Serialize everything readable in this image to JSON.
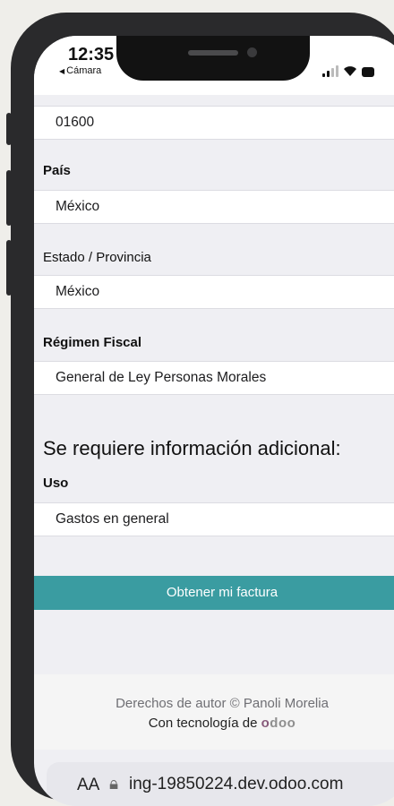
{
  "status_bar": {
    "time": "12:35",
    "back_app": "Cámara"
  },
  "form": {
    "postal_code_value": "01600",
    "country_label": "País",
    "country_value": "México",
    "state_label": "Estado / Provincia",
    "state_value": "México",
    "regime_label": "Régimen Fiscal",
    "regime_value": "General de Ley Personas Morales",
    "additional_title": "Se requiere información adicional:",
    "use_label": "Uso",
    "use_value": "Gastos en general",
    "submit_label": "Obtener mi factura"
  },
  "footer": {
    "copyright": "Derechos de autor © Panoli Morelia",
    "powered_by": "Con tecnología de",
    "brand": "odoo"
  },
  "browser": {
    "aa": "AA",
    "url": "ing-19850224.dev.odoo.com"
  },
  "colors": {
    "accent": "#3a9ca1",
    "brand_o1": "#875a7b",
    "brand_rest": "#8f8f8f"
  }
}
